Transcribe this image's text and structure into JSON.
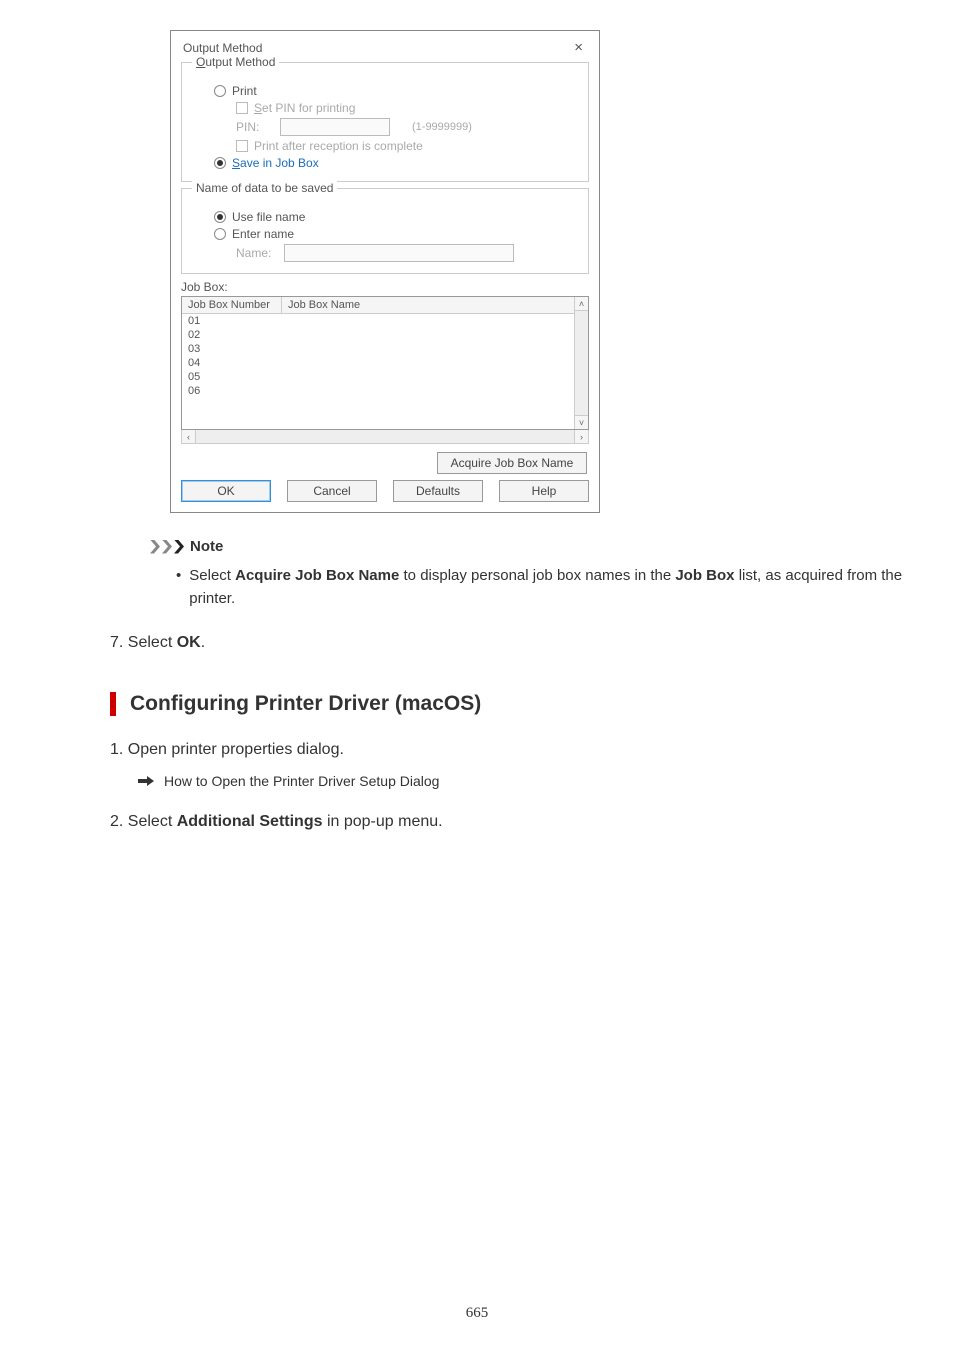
{
  "dialog": {
    "title": "Output Method",
    "group_output_method": {
      "legend": "Output Method",
      "print": "Print",
      "set_pin": "Set PIN for printing",
      "pin_label": "PIN:",
      "pin_hint": "(1-9999999)",
      "print_after_reception": "Print after reception is complete",
      "save_in_job_box": "Save in Job Box"
    },
    "group_name_data": {
      "legend": "Name of data to be saved",
      "use_file_name": "Use file name",
      "enter_name": "Enter name",
      "name_label": "Name:"
    },
    "jobbox_label": "Job Box:",
    "headers": {
      "num": "Job Box Number",
      "name": "Job Box Name"
    },
    "rows": [
      "01",
      "02",
      "03",
      "04",
      "05",
      "06"
    ],
    "acquire_btn": "Acquire Job Box Name",
    "ok": "OK",
    "cancel": "Cancel",
    "defaults": "Defaults",
    "help": "Help"
  },
  "note": {
    "heading": "Note",
    "body_pre": "Select ",
    "body_b1": "Acquire Job Box Name",
    "body_mid": " to display personal job box names in the ",
    "body_b2": "Job Box",
    "body_post": " list, as acquired from the printer."
  },
  "step7": {
    "num": "7.",
    "pre": "Select ",
    "b": "OK",
    "post": "."
  },
  "section": {
    "title": "Configuring Printer Driver (macOS)"
  },
  "step1": {
    "num": "1.",
    "text": "Open printer properties dialog.",
    "link": "How to Open the Printer Driver Setup Dialog"
  },
  "step2": {
    "num": "2.",
    "pre": "Select ",
    "b": "Additional Settings",
    "post": " in pop-up menu."
  },
  "page_number": "665"
}
